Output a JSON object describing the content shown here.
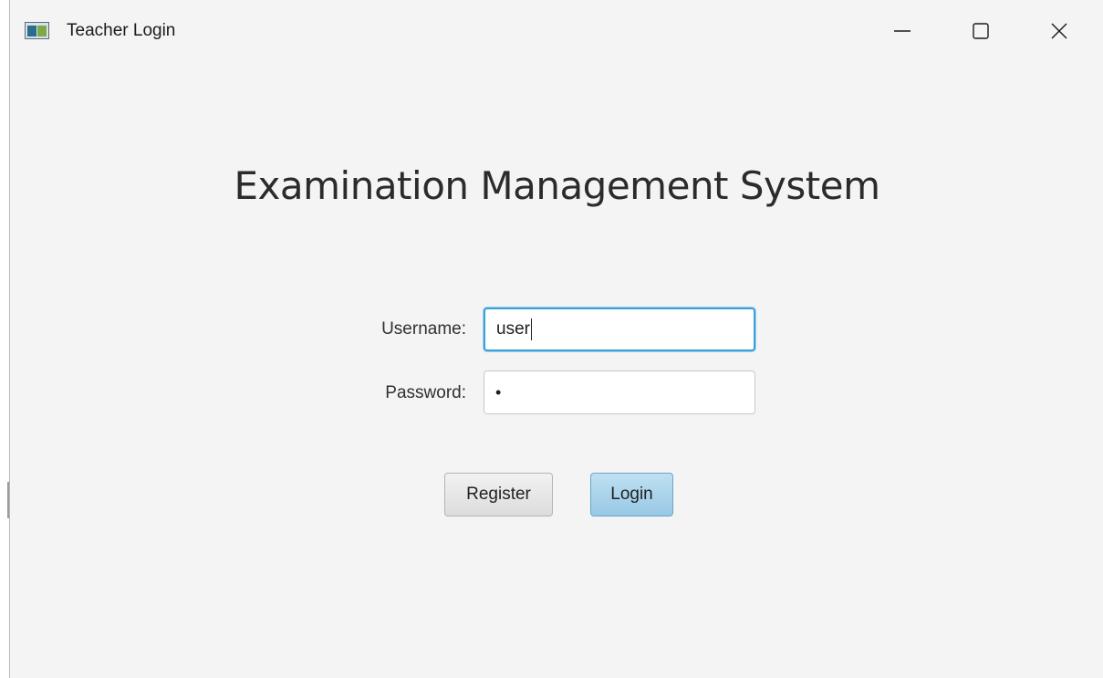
{
  "window": {
    "title": "Teacher Login",
    "controls": {
      "minimize": "minimize-icon",
      "maximize": "maximize-icon",
      "close": "close-icon"
    }
  },
  "main": {
    "heading": "Examination Management System",
    "username": {
      "label": "Username:",
      "value": "user"
    },
    "password": {
      "label": "Password:",
      "masked_value": "•"
    },
    "buttons": {
      "register": "Register",
      "login": "Login"
    }
  },
  "colors": {
    "window_background": "#f4f4f4",
    "focus_border": "#3aa0d8",
    "login_button": "#98c8e4"
  }
}
